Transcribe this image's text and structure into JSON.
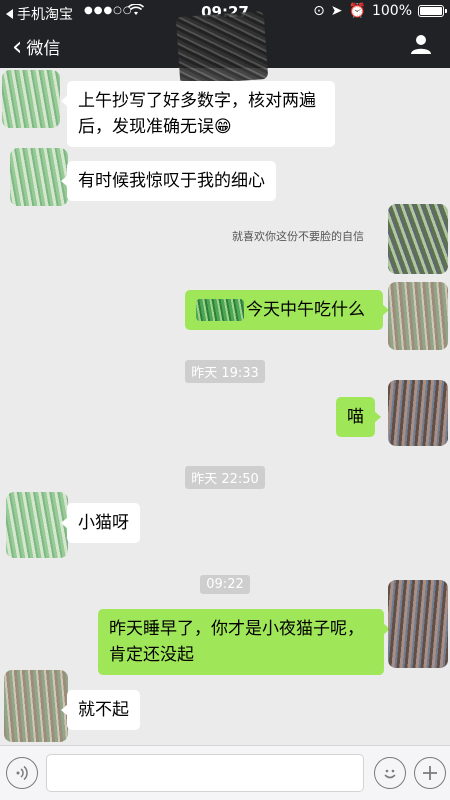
{
  "status_bar": {
    "back_app_label": "手机淘宝",
    "signal": "●●●○○",
    "time": "09:27",
    "battery": "100%"
  },
  "nav": {
    "back_label": "微信"
  },
  "messages": [
    {
      "side": "left",
      "text_line1": "上午抄写了好多数字，核对两遍",
      "text_line2": "后，发现准确无误😁"
    },
    {
      "side": "left",
      "text": "有时候我惊叹于我的细心"
    },
    {
      "note": "就喜欢你这份不要脸的自信"
    },
    {
      "side": "right",
      "text": "今天中午吃什么"
    },
    {
      "time": "昨天 19:33"
    },
    {
      "side": "right",
      "text": "喵"
    },
    {
      "time": "昨天 22:50"
    },
    {
      "side": "left",
      "text": "小猫呀"
    },
    {
      "time": "09:22"
    },
    {
      "side": "right",
      "text_line1": "昨天睡早了，你才是小夜猫子呢，",
      "text_line2": "肯定还没起"
    },
    {
      "side": "left",
      "text": "就不起"
    }
  ],
  "input": {
    "placeholder": ""
  },
  "colors": {
    "header_bg": "#202225",
    "chat_bg": "#ebebeb",
    "right_bubble": "#9fe659",
    "left_bubble": "#ffffff"
  }
}
